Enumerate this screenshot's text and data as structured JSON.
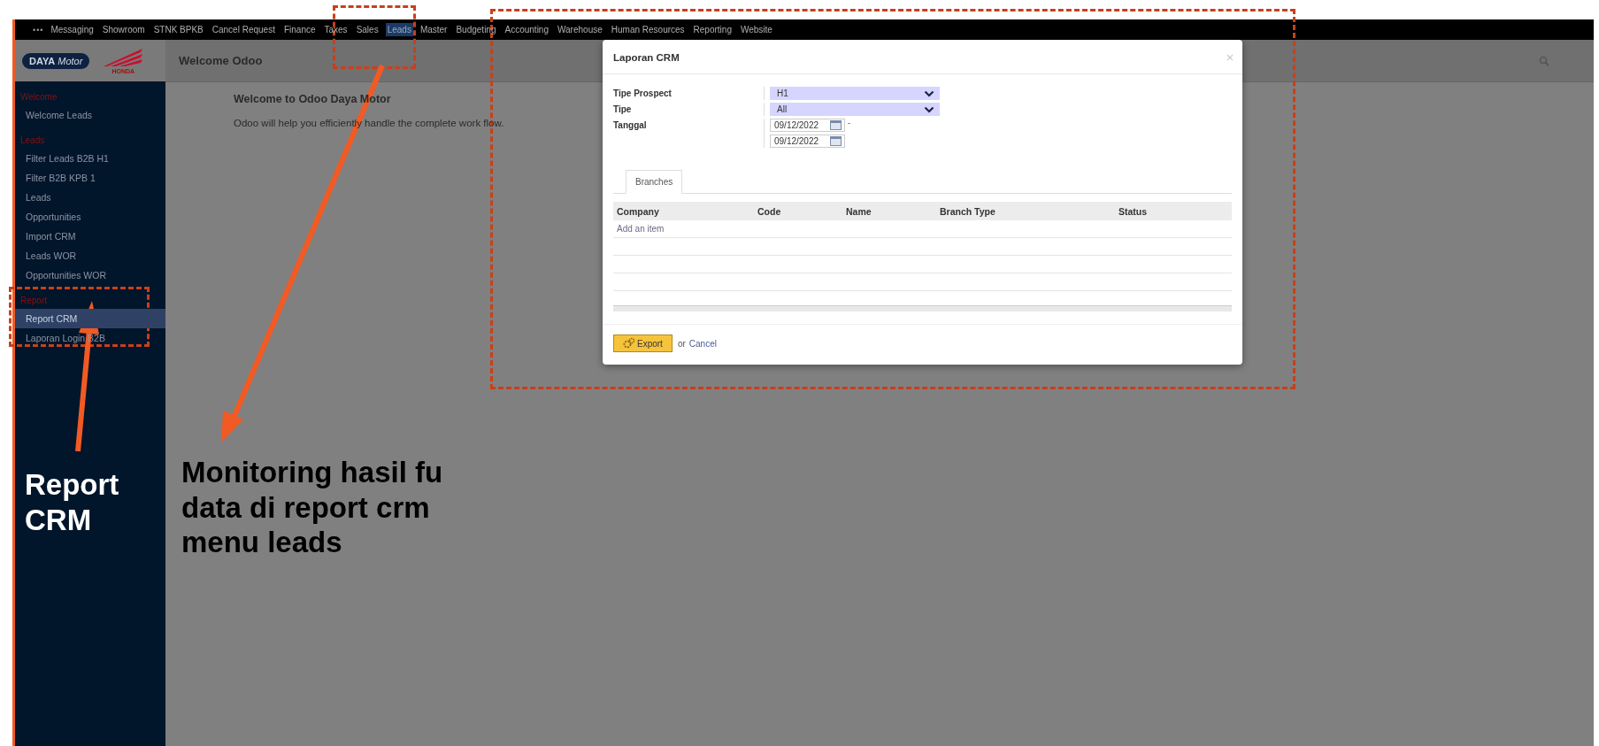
{
  "menu": [
    {
      "label": "Messaging",
      "selected": false
    },
    {
      "label": "Showroom",
      "selected": false
    },
    {
      "label": "STNK BPKB",
      "selected": false
    },
    {
      "label": "Cancel Request",
      "selected": false
    },
    {
      "label": "Finance",
      "selected": false
    },
    {
      "label": "Taxes",
      "selected": false
    },
    {
      "label": "Sales",
      "selected": false
    },
    {
      "label": "Leads",
      "selected": true
    },
    {
      "label": "Master",
      "selected": false
    },
    {
      "label": "Budgeting",
      "selected": false
    },
    {
      "label": "Accounting",
      "selected": false
    },
    {
      "label": "Warehouse",
      "selected": false
    },
    {
      "label": "Human Resources",
      "selected": false
    },
    {
      "label": "Reporting",
      "selected": false
    },
    {
      "label": "Website",
      "selected": false
    }
  ],
  "menu_more": "•••",
  "logo": {
    "brand": "DAYA",
    "word": "Motor",
    "maker": "HONDA"
  },
  "page_title": "Welcome Odoo",
  "sidebar": [
    {
      "heading": "Welcome",
      "items": [
        {
          "label": "Welcome Leads",
          "selected": false
        }
      ]
    },
    {
      "heading": "Leads",
      "items": [
        {
          "label": "Filter Leads B2B H1",
          "selected": false
        },
        {
          "label": "Filter B2B KPB 1",
          "selected": false
        },
        {
          "label": "Leads",
          "selected": false
        },
        {
          "label": "Opportunities",
          "selected": false
        },
        {
          "label": "Import CRM",
          "selected": false
        },
        {
          "label": "Leads WOR",
          "selected": false
        },
        {
          "label": "Opportunities WOR",
          "selected": false
        }
      ]
    },
    {
      "heading": "Report",
      "items": [
        {
          "label": "Report CRM",
          "selected": true
        },
        {
          "label": "Laporan Login B2B",
          "selected": false
        }
      ]
    }
  ],
  "welcome": {
    "heading": "Welcome to Odoo Daya Motor",
    "text": "Odoo will help you efficiently handle the complete work flow."
  },
  "dialog": {
    "title": "Laporan CRM",
    "fields": [
      {
        "label": "Tipe Prospect",
        "kind": "select",
        "values": [
          "H1"
        ]
      },
      {
        "label": "Tipe",
        "kind": "select",
        "values": [
          "All"
        ]
      },
      {
        "label": "Tanggal",
        "kind": "daterange",
        "values": [
          "09/12/2022",
          "09/12/2022"
        ],
        "separator": "-"
      }
    ],
    "tabs": [
      {
        "label": "Branches",
        "selected": true
      }
    ],
    "columns": [
      "Company",
      "Code",
      "Name",
      "Branch Type",
      "Status"
    ],
    "add_item": "Add an item",
    "export": "Export",
    "or": "or",
    "cancel": "Cancel"
  },
  "annotations": {
    "report": "Report CRM",
    "monitoring": "Monitoring hasil fu data di report crm menu leads"
  }
}
